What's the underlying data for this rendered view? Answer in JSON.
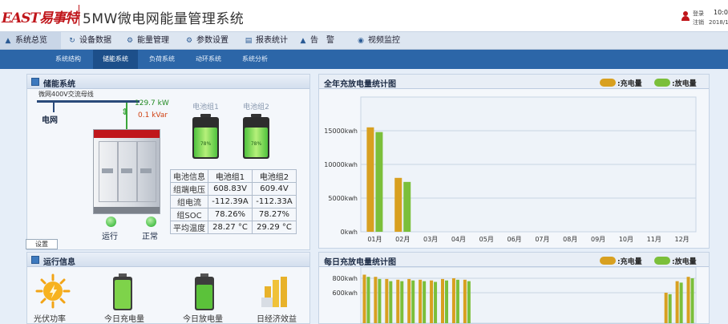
{
  "header": {
    "logo_text": "EAST易事特",
    "app_title": "5MW微电网能量管理系统",
    "login_label": "登录",
    "logout_label": "注销",
    "time": "10:0",
    "date": "2018/1"
  },
  "menu": [
    {
      "label": "系统总览",
      "icon": "home-icon"
    },
    {
      "label": "设备数据",
      "icon": "refresh-icon"
    },
    {
      "label": "能量管理",
      "icon": "flow-icon"
    },
    {
      "label": "参数设置",
      "icon": "gear-icon"
    },
    {
      "label": "报表统计",
      "icon": "report-icon"
    },
    {
      "label": "告　警",
      "icon": "alarm-icon"
    },
    {
      "label": "视频监控",
      "icon": "camera-icon"
    }
  ],
  "subnav": [
    "系统结构",
    "储能系统",
    "负荷系统",
    "动环系统",
    "系统分析"
  ],
  "storage_panel": {
    "title": "储能系统",
    "busbar_label": "微网400V交流母线",
    "grid_label": "电网",
    "active_power": "129.7 kW",
    "reactive_power": "0.1 kVar",
    "status_run": "运行",
    "status_normal": "正常",
    "settings_label": "设置",
    "batteries": [
      {
        "name": "电池组1",
        "pct_text": "78%",
        "fill": 0.78
      },
      {
        "name": "电池组2",
        "pct_text": "78%",
        "fill": 0.78
      }
    ],
    "table": {
      "header": [
        "电池信息",
        "电池组1",
        "电池组2"
      ],
      "rows": [
        [
          "组端电压",
          "608.83V",
          "609.4V"
        ],
        [
          "组电流",
          "-112.39A",
          "-112.33A"
        ],
        [
          "组SOC",
          "78.26%",
          "78.27%"
        ],
        [
          "平均温度",
          "28.27 °C",
          "29.29 °C"
        ]
      ]
    }
  },
  "run_panel": {
    "title": "运行信息",
    "items": [
      {
        "label": "光伏功率",
        "icon": "sun-icon"
      },
      {
        "label": "今日充电量",
        "icon": "battery-icon"
      },
      {
        "label": "今日放电量",
        "icon": "battery-icon"
      },
      {
        "label": "日经济效益",
        "icon": "coins-icon"
      }
    ]
  },
  "annual_chart": {
    "title": "全年充放电量统计图",
    "legend_charge": "充电量",
    "legend_discharge": "放电量",
    "color_charge": "#d8a020",
    "color_discharge": "#7bbf3a"
  },
  "daily_chart": {
    "title": "每日充放电量统计图",
    "legend_charge": "充电量",
    "legend_discharge": "放电量"
  },
  "chart_data": [
    {
      "type": "bar",
      "title": "全年充放电量统计图",
      "categories": [
        "01月",
        "02月",
        "03月",
        "04月",
        "05月",
        "06月",
        "07月",
        "08月",
        "09月",
        "10月",
        "11月",
        "12月"
      ],
      "series": [
        {
          "name": "充电量",
          "values": [
            15500,
            8000,
            0,
            0,
            0,
            0,
            0,
            0,
            0,
            0,
            0,
            0
          ]
        },
        {
          "name": "放电量",
          "values": [
            14800,
            7400,
            0,
            0,
            0,
            0,
            0,
            0,
            0,
            0,
            0,
            0
          ]
        }
      ],
      "yticks": [
        "0kwh",
        "5000kwh",
        "10000kwh",
        "15000kwh"
      ],
      "ylim": [
        0,
        20000
      ],
      "grid": true,
      "legend": "top-right"
    },
    {
      "type": "bar",
      "title": "每日充放电量统计图",
      "series": [
        {
          "name": "充电量",
          "values": [
            850,
            820,
            790,
            780,
            790,
            780,
            770,
            790,
            800,
            780,
            0,
            0,
            0,
            0,
            0,
            0,
            0,
            0,
            0,
            0,
            0,
            0,
            0,
            0,
            0,
            0,
            0,
            600,
            760,
            820
          ]
        },
        {
          "name": "放电量",
          "values": [
            820,
            790,
            760,
            760,
            770,
            760,
            750,
            770,
            780,
            760,
            0,
            0,
            0,
            0,
            0,
            0,
            0,
            0,
            0,
            0,
            0,
            0,
            0,
            0,
            0,
            0,
            0,
            580,
            740,
            800
          ]
        }
      ],
      "yticks": [
        "600kwh",
        "800kwh"
      ],
      "ylim": [
        0,
        1000
      ],
      "grid": true,
      "legend": "top-right"
    }
  ]
}
